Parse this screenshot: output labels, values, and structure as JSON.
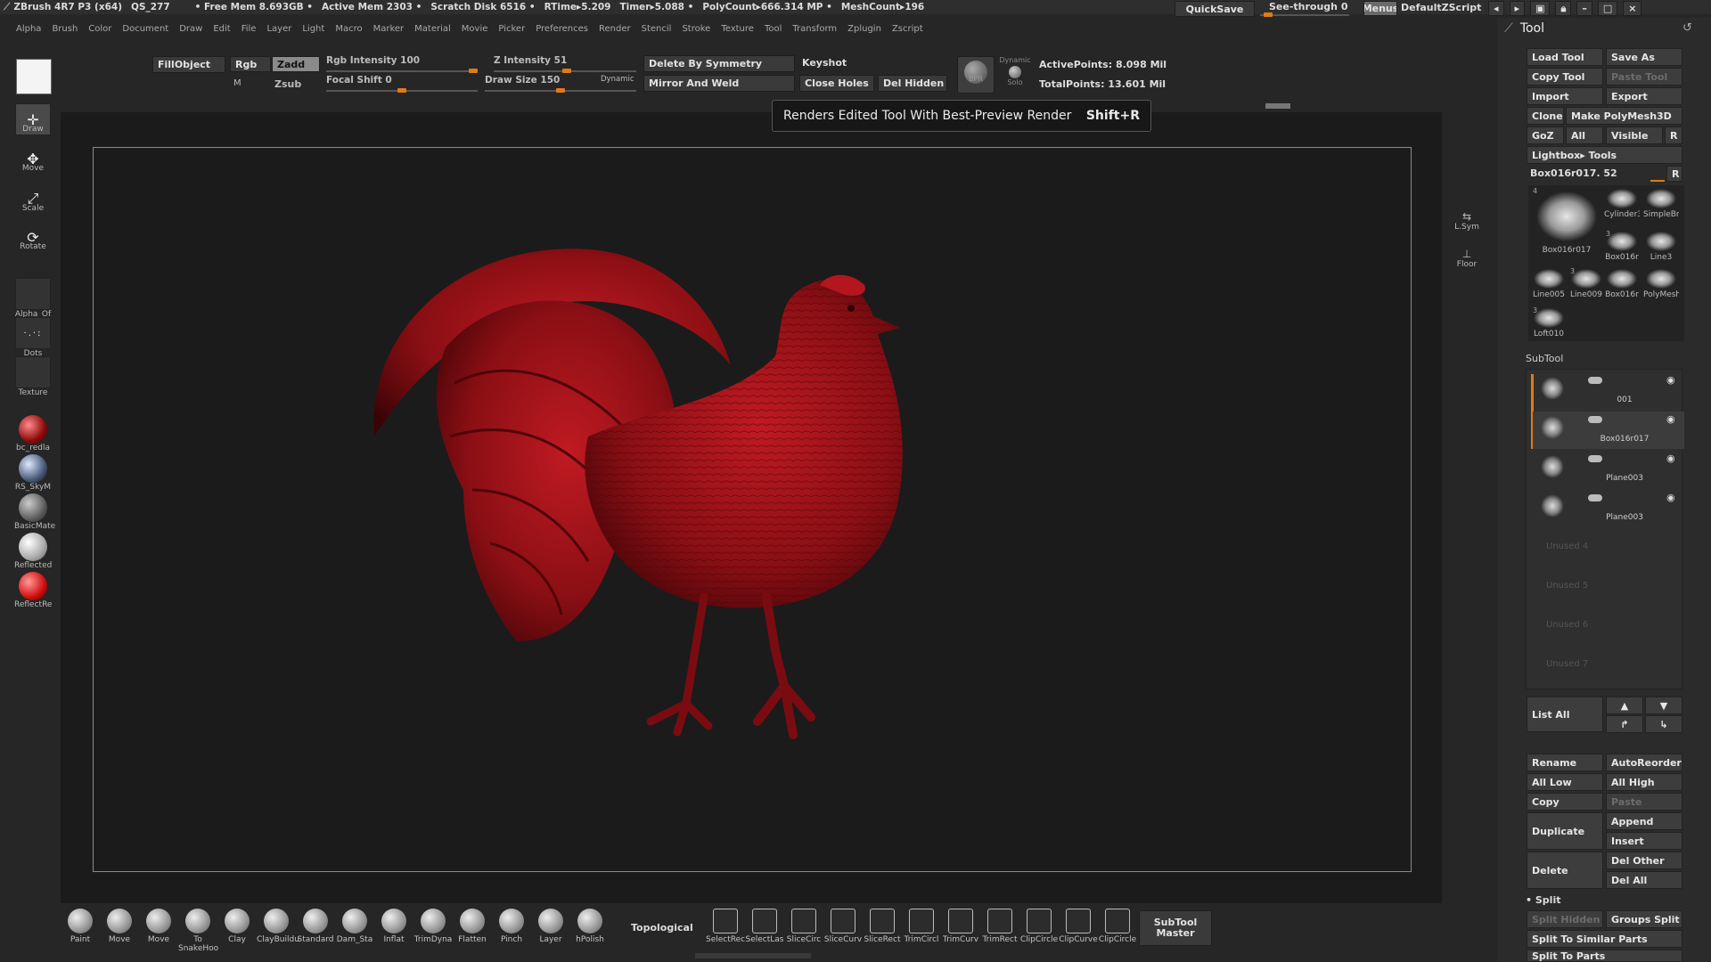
{
  "titlebar": {
    "app": "ZBrush 4R7 P3 (x64)",
    "doc": "QS_277",
    "free_mem": "• Free Mem 8.693GB •",
    "active_mem": "Active Mem 2303 •",
    "scratch": "Scratch Disk 6516 •",
    "rtime": "RTime▸5.209",
    "timer": "Timer▸5.088 •",
    "polycount": "PolyCount▸666.314 MP •",
    "meshcount": "MeshCount▸196",
    "quicksave": "QuickSave",
    "see_through": "See-through  0",
    "menus": "Menus",
    "zscript": "DefaultZScript"
  },
  "menus": [
    "Alpha",
    "Brush",
    "Color",
    "Document",
    "Draw",
    "Edit",
    "File",
    "Layer",
    "Light",
    "Macro",
    "Marker",
    "Material",
    "Movie",
    "Picker",
    "Preferences",
    "Render",
    "Stencil",
    "Stroke",
    "Texture",
    "Tool",
    "Transform",
    "Zplugin",
    "Zscript"
  ],
  "toolbar": {
    "fillobject": "FillObject",
    "rgb": "Rgb",
    "m": "M",
    "zadd": "Zadd",
    "zsub": "Zsub",
    "rgb_intensity": "Rgb Intensity 100",
    "rgb_intensity_value": 100,
    "focal_shift": "Focal Shift 0",
    "focal_shift_value": 0,
    "z_intensity": "Z Intensity 51",
    "z_intensity_value": 51,
    "draw_size": "Draw Size 150",
    "draw_size_value": 150,
    "dynamic": "Dynamic",
    "delete_by_symmetry": "Delete By Symmetry",
    "mirror_and_weld": "Mirror And Weld",
    "keyshot": "Keyshot",
    "close_holes": "Close Holes",
    "del_hidden": "Del Hidden",
    "bpr": "BPR",
    "dynamic_solo": "Dynamic",
    "solo": "Solo",
    "active_points": "ActivePoints: 8.098 Mil",
    "total_points": "TotalPoints: 13.601 Mil"
  },
  "tooltip": {
    "text": "Renders Edited Tool With Best-Preview Render",
    "shortcut": "Shift+R"
  },
  "left_shelf": {
    "draw": "Draw",
    "move": "Move",
    "scale": "Scale",
    "rotate": "Rotate",
    "alpha": "Alpha_Of",
    "dots": "Dots",
    "texture": "Texture",
    "materials": [
      "bc_redla",
      "RS_SkyM",
      "BasicMate",
      "Reflected",
      "ReflectRe"
    ]
  },
  "canvas_side": {
    "lsym": "L.Sym",
    "floor": "Floor"
  },
  "bottom_shelf": {
    "brushes": [
      "Paint",
      "Move",
      "Move",
      "To SnakeHoo",
      "Clay",
      "ClayBuildu",
      "Standard",
      "Dam_Sta",
      "Inflat",
      "TrimDyna",
      "Flatten",
      "Pinch",
      "Layer",
      "hPolish"
    ],
    "topological": "Topological",
    "selection": [
      "SelectRec",
      "SelectLas",
      "SliceCirc",
      "SliceCurv",
      "SliceRect",
      "TrimCircl",
      "TrimCurv",
      "TrimRect",
      "ClipCircle",
      "ClipCurve",
      "ClipCircle"
    ],
    "subtool_master": "SubTool Master"
  },
  "tool_panel": {
    "title": "Tool",
    "load_tool": "Load Tool",
    "save_as": "Save As",
    "copy_tool": "Copy Tool",
    "paste_tool": "Paste Tool",
    "import": "Import",
    "export": "Export",
    "clone": "Clone",
    "make_polymesh": "Make PolyMesh3D",
    "goz": "GoZ",
    "all": "All",
    "visible": "Visible",
    "r": "R",
    "lightbox_tools": "Lightbox▸ Tools",
    "current_tool": "Box016r017. 52",
    "thumbs": [
      {
        "label": "Box016r017",
        "count": "4"
      },
      {
        "label": "Cylinder3",
        "count": ""
      },
      {
        "label": "SimpleBru",
        "count": ""
      },
      {
        "label": "Box016r",
        "count": "3"
      },
      {
        "label": "Line3",
        "count": ""
      },
      {
        "label": "Line005",
        "count": ""
      },
      {
        "label": "Line009",
        "count": "3"
      },
      {
        "label": "Box016r",
        "count": ""
      },
      {
        "label": "PolyMesh",
        "count": ""
      },
      {
        "label": "Loft010",
        "count": "3"
      }
    ],
    "subtool_header": "SubTool",
    "subtools": [
      "001",
      "Box016r017",
      "Plane003",
      "Plane003"
    ],
    "unused": [
      "Unused 4",
      "Unused 5",
      "Unused 6",
      "Unused 7"
    ],
    "list_all": "List  All",
    "rename": "Rename",
    "autoreorder": "AutoReorder",
    "all_low": "All Low",
    "all_high": "All High",
    "copy": "Copy",
    "paste": "Paste",
    "duplicate": "Duplicate",
    "append": "Append",
    "insert": "Insert",
    "delete": "Delete",
    "del_other": "Del Other",
    "del_all": "Del All",
    "split": "Split",
    "split_hidden": "Split Hidden",
    "groups_split": "Groups Split",
    "split_similar": "Split To Similar Parts",
    "split_parts": "Split To Parts"
  },
  "colors": {
    "accent": "#e07a17",
    "model": "#8a0f14",
    "canvas": "#1b1b1b"
  }
}
